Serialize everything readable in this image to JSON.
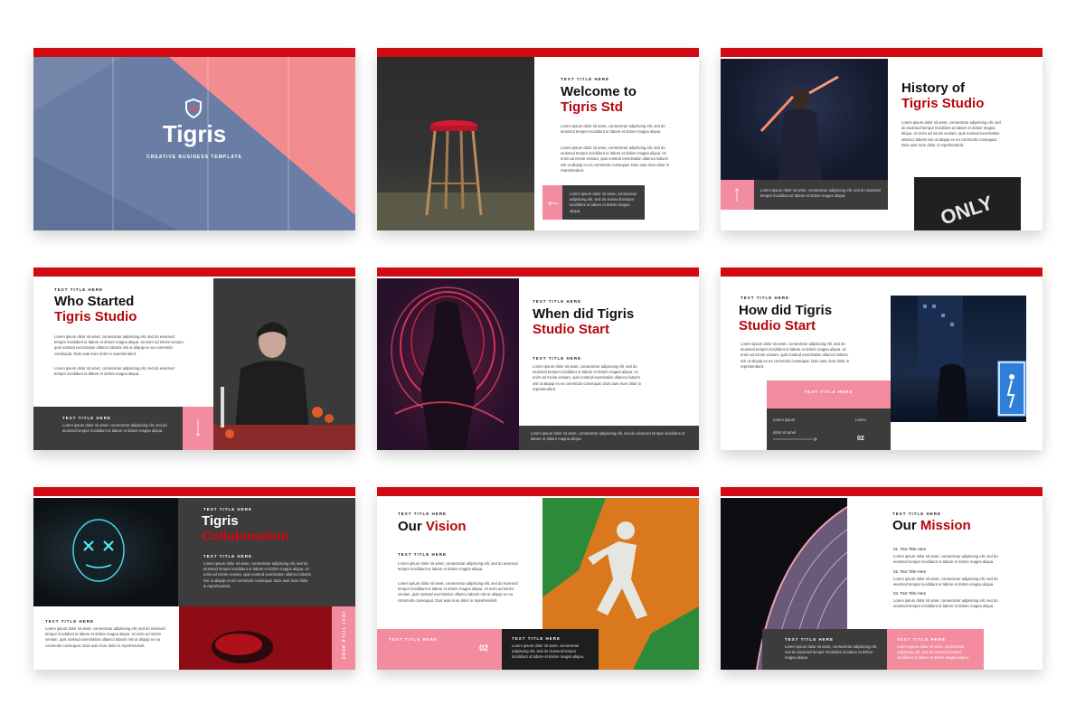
{
  "lorem_short": "Lorem ipsum dolor sit amet, consectetur adipiscing elit, sed do eiusmod tempor incididunt ut labore et dolore magna aliqua.",
  "lorem_long": "Lorem ipsum dolor sit amet, consectetur adipiscing elit, sed do eiusmod tempor incididunt ut labore et dolore magna aliqua. Ut enim ad minim veniam, quis nostrud exercitation ullamco laboris nisi ut aliquip ex ea commodo consequat. Duis aute irure dolor in reprehenderit.",
  "lorem_tiny": "Lorem ipsum dolor sit amet, consectetur adipiscing elit, sed do eiusmod tempor incididunt ut labore et dolore magna aliqua.",
  "text_title": "TEXT TITLE HERE",
  "colors": {
    "accent": "#d10a13",
    "pink": "#f28c9e",
    "dark": "#3c3c3c",
    "title_red": "#b5070d"
  },
  "s1": {
    "title": "Tigris",
    "subtitle": "CREATIVE BUSINESS TEMPLATE",
    "icon": "shield-icon"
  },
  "s2": {
    "kicker": "TEXT TITLE HERE",
    "line1": "Welcome to",
    "line2": "Tigris Std",
    "arrow": "arrow-left-icon"
  },
  "s3": {
    "line1": "History of",
    "line2": "Tigris Studio",
    "caption": "Lorem ipsum dolor sit amet, consectetur adipiscing elit, sed do eiusmod tempor incididunt ut labore et dolore magna aliqua.",
    "road_text": "ONLY"
  },
  "s4": {
    "kicker": "TEXT TITLE HERE",
    "line1": "Who Started",
    "line2": "Tigris Studio",
    "box_title": "TEXT TITLE HERE"
  },
  "s5": {
    "kicker": "TEXT TITLE HERE",
    "line1": "When did Tigris",
    "line2": "Studio Start",
    "sub": "TEXT TITLE HERE"
  },
  "s6": {
    "kicker": "TEXT TITLE HERE",
    "line1": "How did Tigris",
    "line2": "Studio Start",
    "pink_title": "TEXT TITLE HERE",
    "lorem_ipsum": "Lorem ipsum",
    "lorem": "Lorem",
    "dolor": "dolor sit amet",
    "num": "02"
  },
  "s7": {
    "kicker": "TEXT TITLE HERE",
    "line1": "Tigris",
    "line2": "Collaboration",
    "sub": "TEXT TITLE HERE",
    "bottom_title": "TEXT TITLE HERE",
    "vertical": "TEXT TITLE HERE"
  },
  "s8": {
    "kicker": "TEXT TITLE HERE",
    "title_a": "Our ",
    "title_b": "Vision",
    "sub": "TEXT TITLE HERE",
    "pink_title": "TEXT TITLE HERE",
    "num": "02",
    "dark_title": "TEXT TITLE HERE"
  },
  "s9": {
    "kicker": "TEXT TITLE HERE",
    "title_a": "Our ",
    "title_b": "Mission",
    "items": [
      "01. Text Title Here",
      "02. Text Title Here",
      "03. Text Title Here"
    ],
    "dark_title": "TEXT TITLE HERE",
    "pink_title": "TEXT TITLE HERE"
  }
}
